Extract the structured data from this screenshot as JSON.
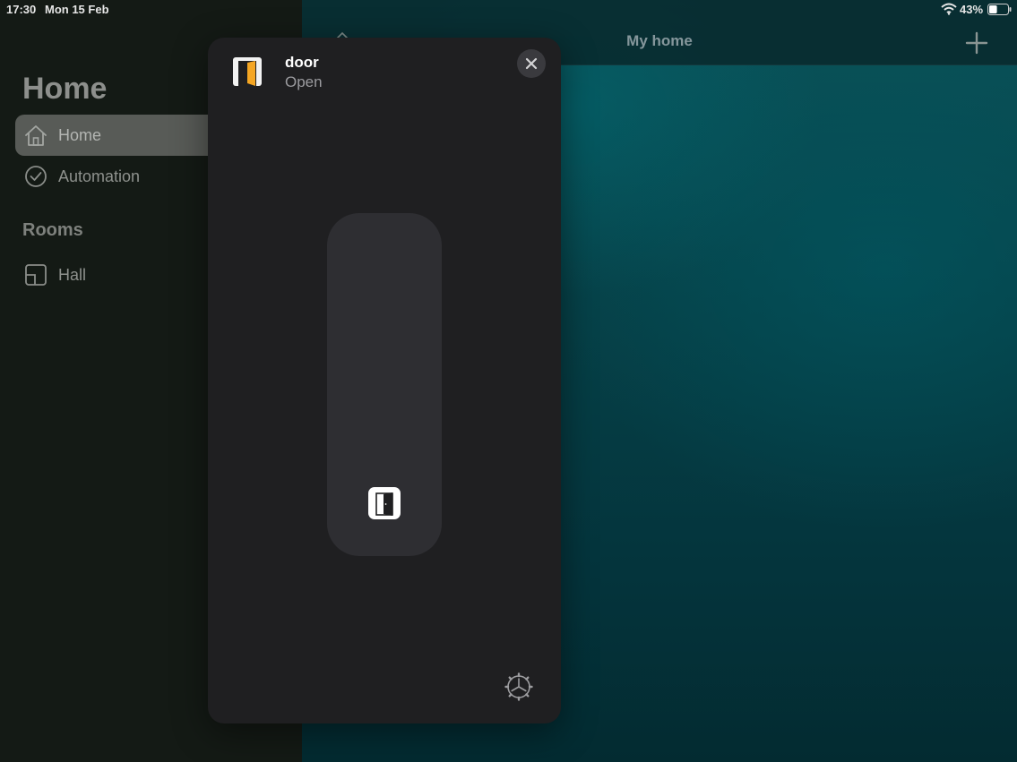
{
  "status_bar": {
    "time": "17:30",
    "date": "Mon 15 Feb",
    "battery_percent": "43%",
    "battery_level": 0.43
  },
  "sidebar": {
    "title": "Home",
    "items": [
      {
        "label": "Home",
        "icon": "house-icon",
        "selected": true
      },
      {
        "label": "Automation",
        "icon": "clock-icon",
        "selected": false
      }
    ],
    "rooms_heading": "Rooms",
    "rooms": [
      {
        "label": "Hall",
        "icon": "room-icon"
      }
    ]
  },
  "content": {
    "title": "My home",
    "add_icon": "plus-icon"
  },
  "accessory_modal": {
    "name": "door",
    "state": "Open",
    "icon": "door-open-icon",
    "accent_color": "#f5a623",
    "close_icon": "close-icon",
    "settings_icon": "gear-icon"
  }
}
